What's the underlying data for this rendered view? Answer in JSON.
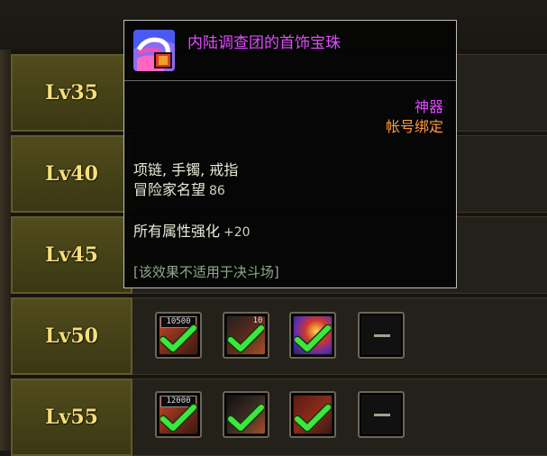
{
  "levels": [
    {
      "label": "Lv35"
    },
    {
      "label": "Lv40"
    },
    {
      "label": "Lv45"
    },
    {
      "label": "Lv50",
      "slots": [
        {
          "type": "item",
          "icon": "necklace-icon",
          "number": "10500",
          "checked": true
        },
        {
          "type": "item",
          "icon": "bracelet-icon",
          "number": "10",
          "checked": true
        },
        {
          "type": "item",
          "icon": "ring-icon",
          "checked": true
        },
        {
          "type": "empty",
          "icon": "dash-icon"
        }
      ]
    },
    {
      "label": "Lv55",
      "slots": [
        {
          "type": "item",
          "icon": "necklace-icon",
          "number": "12000",
          "checked": true
        },
        {
          "type": "item",
          "icon": "bracelet-icon",
          "checked": true
        },
        {
          "type": "item",
          "icon": "ring-icon",
          "checked": true
        },
        {
          "type": "empty",
          "icon": "dash-icon"
        }
      ]
    }
  ],
  "tooltip": {
    "title": "内陆调查团的首饰宝珠",
    "grade": "神器",
    "bind": "帐号绑定",
    "slots_text": "项链, 手镯, 戒指",
    "fame_label": "冒险家名望",
    "fame_value": "86",
    "stat_label": "所有属性强化",
    "stat_value": "+20",
    "note": "[该效果不适用于决斗场]",
    "colors": {
      "title": "#e04bff",
      "bind": "#ff9a3c",
      "note": "#8fa98c"
    }
  }
}
